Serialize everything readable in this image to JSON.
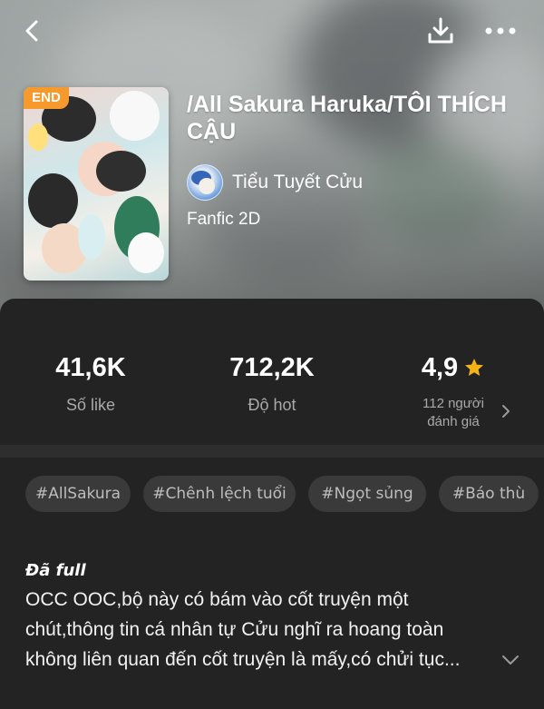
{
  "header": {
    "back_icon": "back-icon",
    "download_icon": "download-icon",
    "more_icon": "more-icon"
  },
  "book": {
    "badge": "END",
    "title": "/All Sakura Haruka/TÔI THÍCH CẬU",
    "author": "Tiểu Tuyết Cửu",
    "category": "Fanfic 2D"
  },
  "stats": {
    "likes": {
      "value": "41,6K",
      "label": "Số like"
    },
    "hot": {
      "value": "712,2K",
      "label": "Độ hot"
    },
    "rating": {
      "value": "4,9",
      "count_line1": "112 người",
      "count_line2": "đánh giá",
      "star_color": "#f5b315"
    }
  },
  "tags": [
    "#AllSakura",
    "#Chênh lệch tuổi",
    "#Ngọt sủng",
    "#Báo thù"
  ],
  "description": {
    "status": "Đã full",
    "lines": [
      "OCC OOC,bộ này có bám vào cốt truyện một",
      "chút,thông tin cá nhân tự Cửu nghĩ ra hoang toàn",
      "không liên quan đến cốt truyện là mấy,có chửi tục..."
    ]
  },
  "colors": {
    "badge": "#f79a2e",
    "panel_bg": "#232323",
    "tag_bg": "#3a3a3a",
    "star": "#f5b315"
  }
}
